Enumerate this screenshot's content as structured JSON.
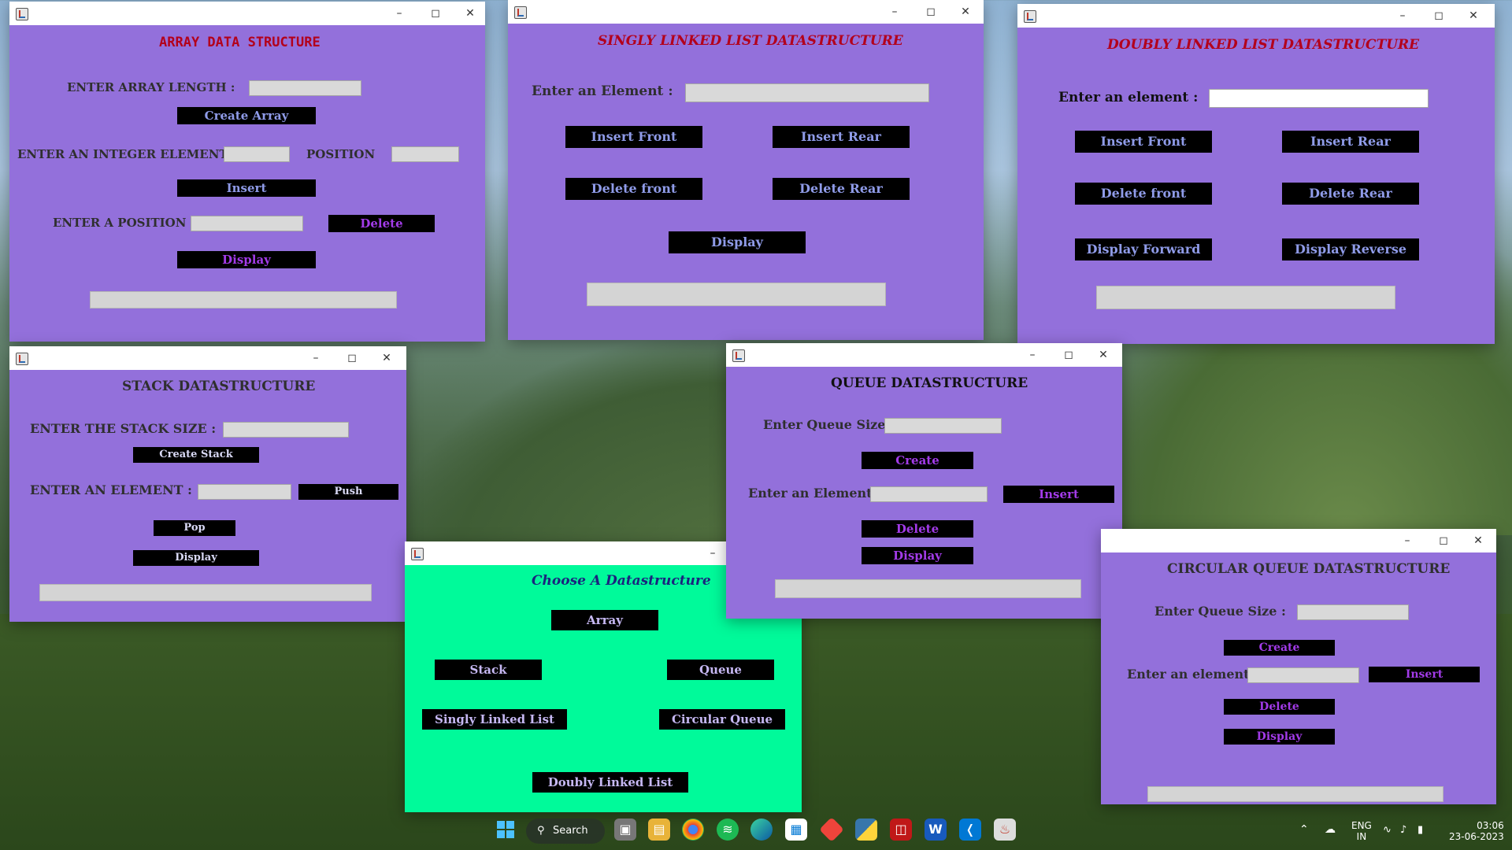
{
  "taskbar": {
    "search_label": "Search",
    "lang_primary": "ENG",
    "lang_secondary": "IN",
    "time": "03:06",
    "date": "23-06-2023"
  },
  "array_window": {
    "title": "ARRAY DATA STRUCTURE",
    "length_label": "ENTER ARRAY LENGTH :",
    "create_btn": "Create Array",
    "element_label": "ENTER AN INTEGER ELEMENT",
    "position_label": "POSITION",
    "insert_btn": "Insert",
    "delete_pos_label": "ENTER A POSITION",
    "delete_btn": "Delete",
    "display_btn": "Display"
  },
  "sll_window": {
    "title": "SINGLY LINKED LIST DATASTRUCTURE",
    "element_label": "Enter an Element :",
    "insert_front": "Insert Front",
    "insert_rear": "Insert Rear",
    "delete_front": "Delete front",
    "delete_rear": "Delete Rear",
    "display": "Display"
  },
  "dll_window": {
    "title": "DOUBLY LINKED LIST DATASTRUCTURE",
    "element_label": "Enter an element :",
    "insert_front": "Insert Front",
    "insert_rear": "Insert Rear",
    "delete_front": "Delete front",
    "delete_rear": "Delete Rear",
    "display_forward": "Display Forward",
    "display_reverse": "Display Reverse"
  },
  "stack_window": {
    "title": "STACK DATASTRUCTURE",
    "size_label": "ENTER THE STACK SIZE :",
    "create_btn": "Create Stack",
    "element_label": "ENTER AN ELEMENT :",
    "push_btn": "Push",
    "pop_btn": "Pop",
    "display_btn": "Display"
  },
  "queue_window": {
    "title": "QUEUE DATASTRUCTURE",
    "size_label": "Enter Queue Size :",
    "create_btn": "Create",
    "element_label": "Enter an Element :",
    "insert_btn": "Insert",
    "delete_btn": "Delete",
    "display_btn": "Display"
  },
  "cq_window": {
    "title": "CIRCULAR QUEUE DATASTRUCTURE",
    "size_label": "Enter Queue Size :",
    "create_btn": "Create",
    "element_label": "Enter an element:",
    "insert_btn": "Insert",
    "delete_btn": "Delete",
    "display_btn": "Display"
  },
  "chooser_window": {
    "title": "Choose A Datastructure",
    "array": "Array",
    "stack": "Stack",
    "queue": "Queue",
    "sll": "Singly Linked List",
    "cq": "Circular Queue",
    "dll": "Doubly Linked List"
  },
  "colors": {
    "window_bg": "#9370db",
    "chooser_bg": "#00fa9a",
    "title_red": "#b3001b",
    "button_bg": "#000000"
  }
}
